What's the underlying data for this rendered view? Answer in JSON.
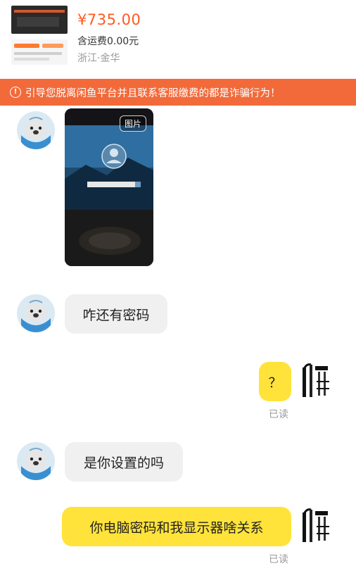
{
  "product": {
    "price": "¥735.00",
    "shipping": "含运费0.00元",
    "location": "浙江·金华"
  },
  "banner": {
    "icon": "warning-circle-icon",
    "text": "引导您脱离闲鱼平台并且联系客服缴费的都是诈骗行为！"
  },
  "messages": {
    "image_label": "图片",
    "m1": "咋还有密码",
    "m2": "？",
    "m2_status": "已读",
    "m3": "是你设置的吗",
    "m4": "你电脑密码和我显示器啥关系",
    "m4_status": "已读"
  },
  "colors": {
    "accent": "#ff5a1f",
    "banner": "#f26a3a",
    "outgoing_bubble": "#ffe33a",
    "incoming_bubble": "#f0f0f0"
  }
}
